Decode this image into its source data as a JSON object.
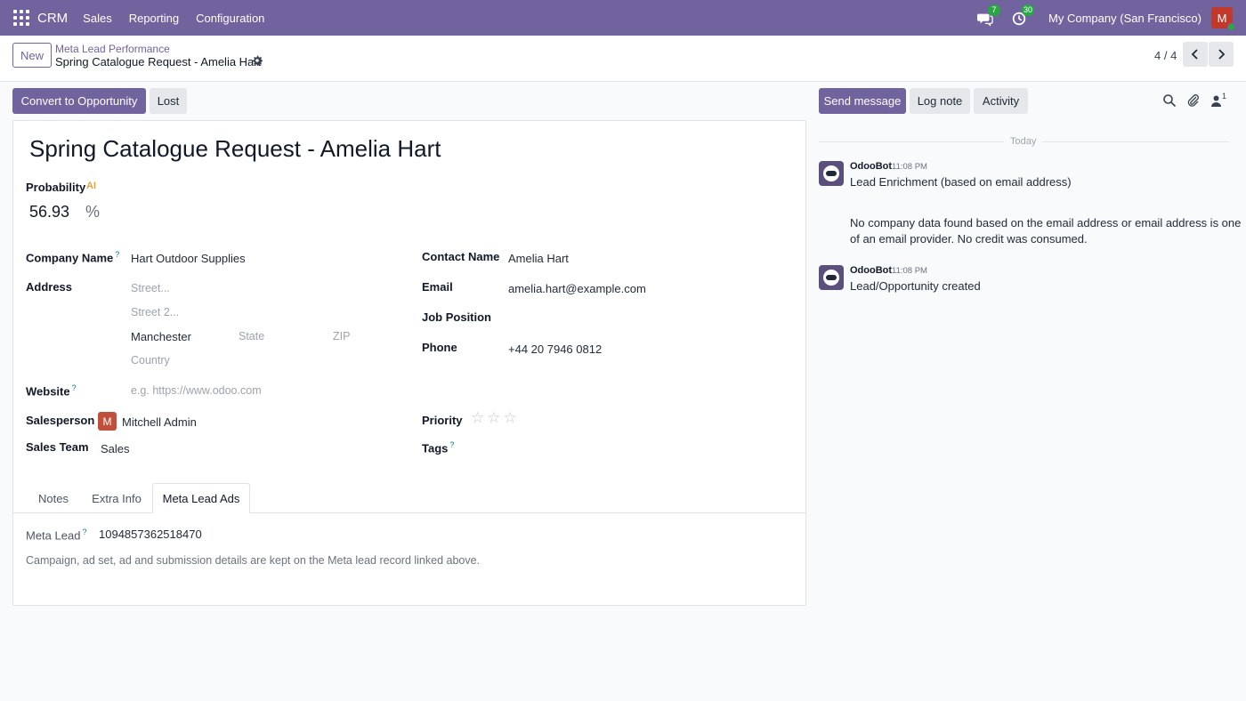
{
  "navbar": {
    "app_name": "CRM",
    "menu": [
      "Sales",
      "Reporting",
      "Configuration"
    ],
    "messages_count": "7",
    "activities_count": "30",
    "company": "My Company (San Francisco)",
    "user_initial": "M",
    "bg_color": "#71639e"
  },
  "control": {
    "new_label": "New",
    "breadcrumb_parent": "Meta Lead Performance",
    "breadcrumb_current": "Spring Catalogue Request - Amelia Hart",
    "pager": "4 / 4"
  },
  "actions": {
    "convert": "Convert to Opportunity",
    "lost": "Lost",
    "send_message": "Send message",
    "log_note": "Log note",
    "activity": "Activity",
    "followers_count": "1"
  },
  "form": {
    "title": "Spring Catalogue Request - Amelia Hart",
    "probability_label": "Probability",
    "ai_badge": "AI",
    "probability_value": "56.93",
    "probability_unit": "%",
    "company_name_label": "Company Name",
    "company_name": "Hart Outdoor Supplies",
    "address_label": "Address",
    "street_placeholder": "Street...",
    "street2_placeholder": "Street 2...",
    "city": "Manchester",
    "state_placeholder": "State",
    "zip_placeholder": "ZIP",
    "country_placeholder": "Country",
    "website_label": "Website",
    "website_placeholder": "e.g. https://www.odoo.com",
    "salesperson_label": "Salesperson",
    "salesperson_initial": "M",
    "salesperson": "Mitchell Admin",
    "sales_team_label": "Sales Team",
    "sales_team": "Sales",
    "contact_name_label": "Contact Name",
    "contact_name": "Amelia Hart",
    "email_label": "Email",
    "email": "amelia.hart@example.com",
    "job_position_label": "Job Position",
    "phone_label": "Phone",
    "phone": "+44 20 7946 0812",
    "priority_label": "Priority",
    "priority_stars": 0,
    "tags_label": "Tags",
    "help_mark": "?"
  },
  "tabs": {
    "notes": "Notes",
    "extra_info": "Extra Info",
    "meta_lead_ads": "Meta Lead Ads",
    "active": "Meta Lead Ads"
  },
  "meta_tab": {
    "meta_lead_label": "Meta Lead",
    "meta_lead_value": "1094857362518470",
    "note": "Campaign, ad set, ad and submission details are kept on the Meta lead record linked above."
  },
  "chatter": {
    "today": "Today",
    "messages": [
      {
        "author": "OdooBot",
        "time": "11:08 PM",
        "line1": "Lead Enrichment (based on email address)",
        "line2": "No company data found based on the email address or email address is one",
        "line3": "of an email provider. No credit was consumed."
      },
      {
        "author": "OdooBot",
        "time": "11:08 PM",
        "line1": "Lead/Opportunity created"
      }
    ]
  }
}
